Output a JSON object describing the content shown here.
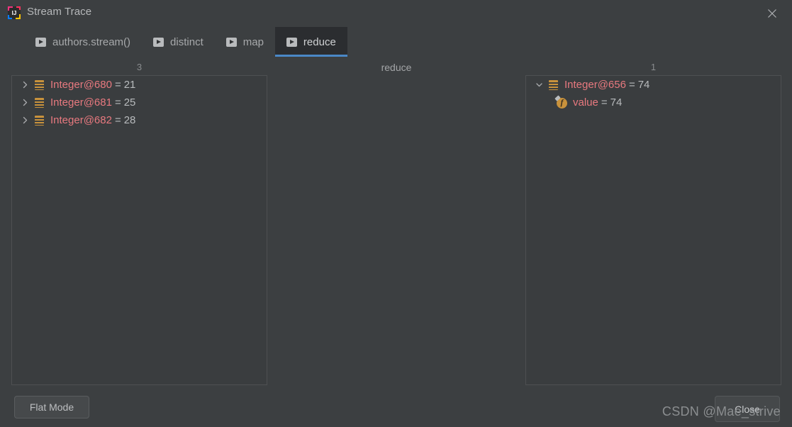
{
  "window": {
    "title": "Stream Trace",
    "logo_icon": "intellij-idea-logo",
    "close_icon": "close-x-icon"
  },
  "tabs": [
    {
      "label": "authors.stream()",
      "icon": "stream-step-icon",
      "selected": false
    },
    {
      "label": "distinct",
      "icon": "stream-step-icon",
      "selected": false
    },
    {
      "label": "map",
      "icon": "stream-step-icon",
      "selected": false
    },
    {
      "label": "reduce",
      "icon": "stream-step-icon",
      "selected": true
    }
  ],
  "columns": {
    "left_count": "3",
    "operation": "reduce",
    "right_count": "1"
  },
  "left_panel": {
    "rows": [
      {
        "chevron": "chevron-right-icon",
        "icon": "array-list-icon",
        "name": "Integer@680",
        "eq": "=",
        "value": "21"
      },
      {
        "chevron": "chevron-right-icon",
        "icon": "array-list-icon",
        "name": "Integer@681",
        "eq": "=",
        "value": "25"
      },
      {
        "chevron": "chevron-right-icon",
        "icon": "array-list-icon",
        "name": "Integer@682",
        "eq": "=",
        "value": "28"
      }
    ]
  },
  "right_panel": {
    "rows": [
      {
        "chevron": "chevron-down-icon",
        "icon": "array-list-icon",
        "name": "Integer@656",
        "eq": "=",
        "value": "74",
        "indent": false
      },
      {
        "chevron": "",
        "icon": "field-icon",
        "name": "value",
        "eq": "=",
        "value": "74",
        "indent": true
      }
    ]
  },
  "footer": {
    "flat_mode_label": "Flat Mode",
    "close_label": "Close"
  },
  "watermark": {
    "text": "CSDN @Mae_strive"
  },
  "colors": {
    "background": "#3c3f41",
    "panel_background": "#3a3d3f",
    "panel_border": "#4e5052",
    "selected_tab_background": "#2b2d30",
    "tab_underline": "#4a88c7",
    "node_name": "#e8797f",
    "node_value": "#b8bbbd",
    "icon_gold": "#c8923c",
    "text_primary": "#b6b8ba",
    "text_muted": "#8a8d8f"
  }
}
